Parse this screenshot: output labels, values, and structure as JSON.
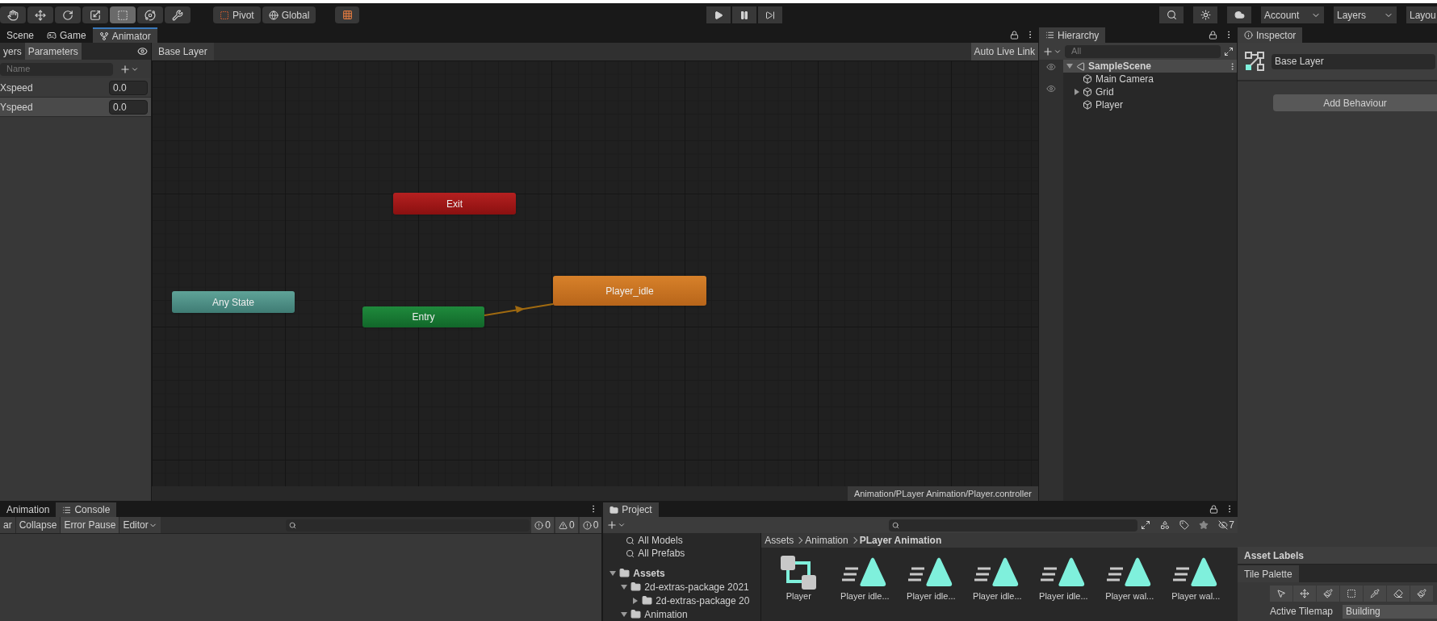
{
  "toolbar": {
    "tools": [
      {
        "kind": "hand",
        "selected": false
      },
      {
        "kind": "move",
        "selected": false
      },
      {
        "kind": "rotate",
        "selected": false
      },
      {
        "kind": "scale",
        "selected": false
      },
      {
        "kind": "rect",
        "selected": true
      },
      {
        "kind": "transform",
        "selected": false
      },
      {
        "kind": "custom",
        "selected": false
      }
    ],
    "pivot": "Pivot",
    "global": "Global",
    "account": "Account",
    "layers": "Layers",
    "layout": "Layou"
  },
  "animator": {
    "tabs": [
      {
        "label": "Scene",
        "kind": "scene",
        "selected": false
      },
      {
        "label": "Game",
        "kind": "game",
        "selected": false
      },
      {
        "label": "Animator",
        "kind": "animator",
        "selected": true
      }
    ],
    "side_tabs": [
      {
        "label": "yers",
        "selected": false
      },
      {
        "label": "Parameters",
        "selected": true
      }
    ],
    "search": {
      "placeholder": "Name"
    },
    "parameters": [
      {
        "name": "Xspeed",
        "value": "0.0",
        "selected": false
      },
      {
        "name": "Yspeed",
        "value": "0.0",
        "selected": true
      }
    ],
    "breadcrumb": "Base Layer",
    "live_link": "Auto Live Link",
    "nodes": [
      {
        "label": "Exit",
        "kind": "exit"
      },
      {
        "label": "Any State",
        "kind": "any"
      },
      {
        "label": "Entry",
        "kind": "entry"
      },
      {
        "label": "Player_idle",
        "kind": "default"
      }
    ],
    "path": "Animation/PLayer Animation/Player.controller"
  },
  "hierarchy": {
    "title": "Hierarchy",
    "search": {
      "placeholder": "All"
    },
    "scene": "SampleScene",
    "expanded": true,
    "items": [
      {
        "label": "Main Camera",
        "has_children": false
      },
      {
        "label": "Grid",
        "has_children": true
      },
      {
        "label": "Player",
        "has_children": false
      }
    ]
  },
  "inspector": {
    "title": "Inspector",
    "name": "Base Layer",
    "button": "Add Behaviour",
    "asset_labels": "Asset Labels",
    "tile_palette": "Tile Palette",
    "active_tilemap_label": "Active Tilemap",
    "active_tilemap": "Building"
  },
  "console": {
    "tabs": [
      {
        "label": "Animation",
        "selected": false
      },
      {
        "label": "Console",
        "selected": true
      }
    ],
    "buttons": [
      {
        "label": "ar",
        "on": false
      },
      {
        "label": "Collapse",
        "on": false
      },
      {
        "label": "Error Pause",
        "on": true
      }
    ],
    "editor": "Editor",
    "counts": [
      "0",
      "0",
      "0"
    ]
  },
  "project": {
    "title": "Project",
    "hidden_count": "7",
    "favorites": [
      "All Models",
      "All Prefabs"
    ],
    "tree": [
      {
        "label": "Assets",
        "expanded": true,
        "children": [
          {
            "label": "2d-extras-package 2021",
            "expanded": true,
            "children": [
              {
                "label": "2d-extras-package 20",
                "expanded": false
              }
            ]
          },
          {
            "label": "Animation",
            "expanded": true
          }
        ]
      }
    ],
    "breadcrumb": [
      "Assets",
      "Animation",
      "PLayer Animation"
    ],
    "assets": [
      {
        "label": "Player",
        "kind": "controller"
      },
      {
        "label": "Player idle...",
        "kind": "clip"
      },
      {
        "label": "Player idle...",
        "kind": "clip"
      },
      {
        "label": "Player idle...",
        "kind": "clip"
      },
      {
        "label": "Player idle...",
        "kind": "clip"
      },
      {
        "label": "Player wal...",
        "kind": "clip"
      },
      {
        "label": "Player wal...",
        "kind": "clip"
      }
    ]
  }
}
